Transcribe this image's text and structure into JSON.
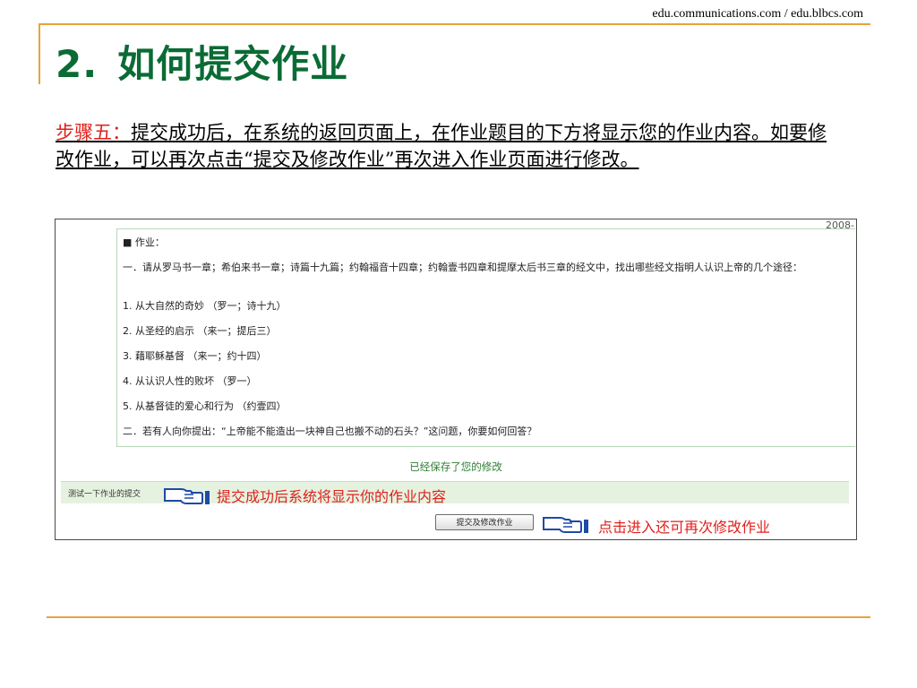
{
  "header": {
    "source": "edu.communications.com / edu.blbcs.com"
  },
  "slide": {
    "number": "2.",
    "title": "如何提交作业"
  },
  "step": {
    "label": "步骤五：",
    "text": "提交成功后，在系统的返回页面上，在作业题目的下方将显示您的作业内容。如要修改作业，可以再次点击“提交及修改作业”再次进入作业页面进行修改。"
  },
  "screenshot": {
    "year": "2008-",
    "homework_lines": [
      "■ 作业：",
      "一．请从罗马书一章；希伯来书一章；诗篇十九篇；约翰福音十四章；约翰壹书四章和提摩太后书三章的经文中，找出哪些经文指明人认识上帝的几个途径：",
      "1. 从大自然的奇妙 （罗一；诗十九）",
      "2. 从圣经的启示 （来一；提后三）",
      "3. 藉耶稣基督 （来一；约十四）",
      "4. 从认识人性的败坏 （罗一）",
      "5. 从基督徒的爱心和行为 （约壹四）",
      "二．若有人向你提出：“上帝能不能造出一块神自己也搬不动的石头？”这问题，你要如何回答？"
    ],
    "saved_message": "已经保存了您的修改",
    "test_label": "测试一下作业的提交",
    "annotation_1": "提交成功后系统将显示你的作业内容",
    "submit_button": "提交及修改作业",
    "annotation_2": "点击进入还可再次修改作业",
    "icon": "pointing-hand-icon",
    "annotation_color": "#e0201c"
  }
}
